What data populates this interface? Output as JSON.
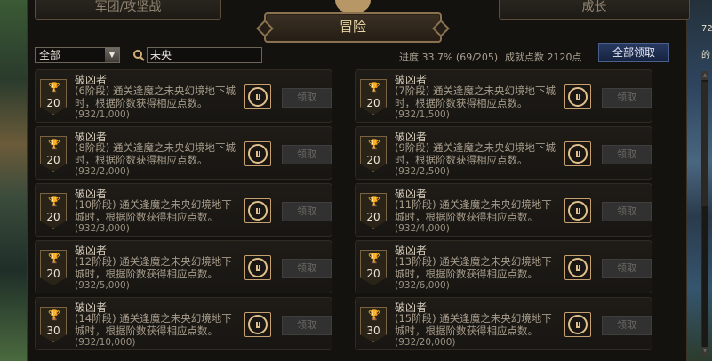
{
  "tabs": {
    "war": "军团/攻坚战",
    "growth": "成长",
    "adventure": "冒险"
  },
  "filter": {
    "category_selected": "全部",
    "search_value": "未央"
  },
  "summary": {
    "progress": "进度 33.7% (69/205)",
    "points": "成就点数 2120点",
    "claim_all": "全部领取"
  },
  "side_text": {
    "right": "72 的"
  },
  "achievements": [
    {
      "title": "破凶者",
      "points": "20",
      "desc": "(6阶段) 通关逢魔之未央幻境地下城时，根据阶数获得相应点数。",
      "count": "(932/1,000)",
      "claim": "领取"
    },
    {
      "title": "破凶者",
      "points": "20",
      "desc": "(7阶段) 通关逢魔之未央幻境地下城时，根据阶数获得相应点数。",
      "count": "(932/1,500)",
      "claim": "领取"
    },
    {
      "title": "破凶者",
      "points": "20",
      "desc": "(8阶段) 通关逢魔之未央幻境地下城时，根据阶数获得相应点数。",
      "count": "(932/2,000)",
      "claim": "领取"
    },
    {
      "title": "破凶者",
      "points": "20",
      "desc": "(9阶段) 通关逢魔之未央幻境地下城时，根据阶数获得相应点数。",
      "count": "(932/2,500)",
      "claim": "领取"
    },
    {
      "title": "破凶者",
      "points": "20",
      "desc": "(10阶段) 通关逢魔之未央幻境地下城时，根据阶数获得相应点数。",
      "count": "(932/3,000)",
      "claim": "领取"
    },
    {
      "title": "破凶者",
      "points": "20",
      "desc": "(11阶段) 通关逢魔之未央幻境地下城时，根据阶数获得相应点数。",
      "count": "(932/4,000)",
      "claim": "领取"
    },
    {
      "title": "破凶者",
      "points": "20",
      "desc": "(12阶段) 通关逢魔之未央幻境地下城时，根据阶数获得相应点数。",
      "count": "(932/5,000)",
      "claim": "领取"
    },
    {
      "title": "破凶者",
      "points": "20",
      "desc": "(13阶段) 通关逢魔之未央幻境地下城时，根据阶数获得相应点数。",
      "count": "(932/6,000)",
      "claim": "领取"
    },
    {
      "title": "破凶者",
      "points": "30",
      "desc": "(14阶段) 通关逢魔之未央幻境地下城时，根据阶数获得相应点数。",
      "count": "(932/10,000)",
      "claim": "领取"
    },
    {
      "title": "破凶者",
      "points": "30",
      "desc": "(15阶段) 通关逢魔之未央幻境地下城时，根据阶数获得相应点数。",
      "count": "(932/20,000)",
      "claim": "领取"
    }
  ],
  "icons": {
    "trophy": "trophy-icon",
    "badge": "achievement-badge-icon",
    "search": "search-icon",
    "dropdown": "chevron-down-icon"
  }
}
